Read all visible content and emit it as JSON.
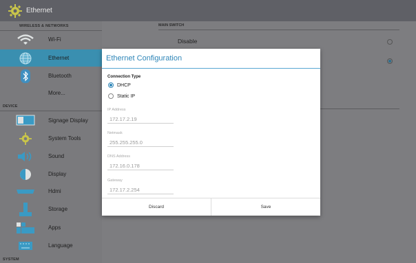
{
  "titlebar": {
    "title": "Ethernet",
    "icon": "gear-icon"
  },
  "sidebar": {
    "sections": {
      "wireless": "WIRELESS & NETWORKS",
      "device": "DEVICE",
      "system": "SYSTEM"
    },
    "items": [
      {
        "label": "Wi-Fi",
        "icon": "wifi-icon"
      },
      {
        "label": "Ethernet",
        "icon": "globe-icon",
        "selected": true
      },
      {
        "label": "Bluetooth",
        "icon": "bluetooth-icon"
      },
      {
        "label": "More...",
        "icon": ""
      },
      {
        "label": "Signage Display",
        "icon": "display-icon"
      },
      {
        "label": "System Tools",
        "icon": "gear-icon"
      },
      {
        "label": "Sound",
        "icon": "speaker-icon"
      },
      {
        "label": "Display",
        "icon": "brightness-icon"
      },
      {
        "label": "Hdmi",
        "icon": "hdmi-icon"
      },
      {
        "label": "Storage",
        "icon": "storage-icon"
      },
      {
        "label": "Apps",
        "icon": "apps-icon"
      },
      {
        "label": "Language",
        "icon": "keyboard-icon"
      }
    ]
  },
  "main": {
    "switch_header": "MAIN SWITCH",
    "disable_label": "Disable",
    "disable_selected": false,
    "enable_selected": true
  },
  "dialog": {
    "title": "Ethernet Configuration",
    "connection_type_label": "Connection Type",
    "options": {
      "dhcp": "DHCP",
      "static": "Static IP"
    },
    "selected_option": "dhcp",
    "fields": {
      "ip_label": "IP Address",
      "ip_value": "172.17.2.19",
      "netmask_label": "Netmask",
      "netmask_value": "255.255.255.0",
      "dns_label": "DNS Address",
      "dns_value": "172.16.0.178",
      "gateway_label": "Gateway",
      "gateway_value": "172.17.2.254"
    },
    "discard_label": "Discard",
    "save_label": "Save"
  },
  "colors": {
    "accent": "#2f86b8",
    "selected_bg": "#3a8fb0",
    "titlebar": "#5f6066"
  }
}
